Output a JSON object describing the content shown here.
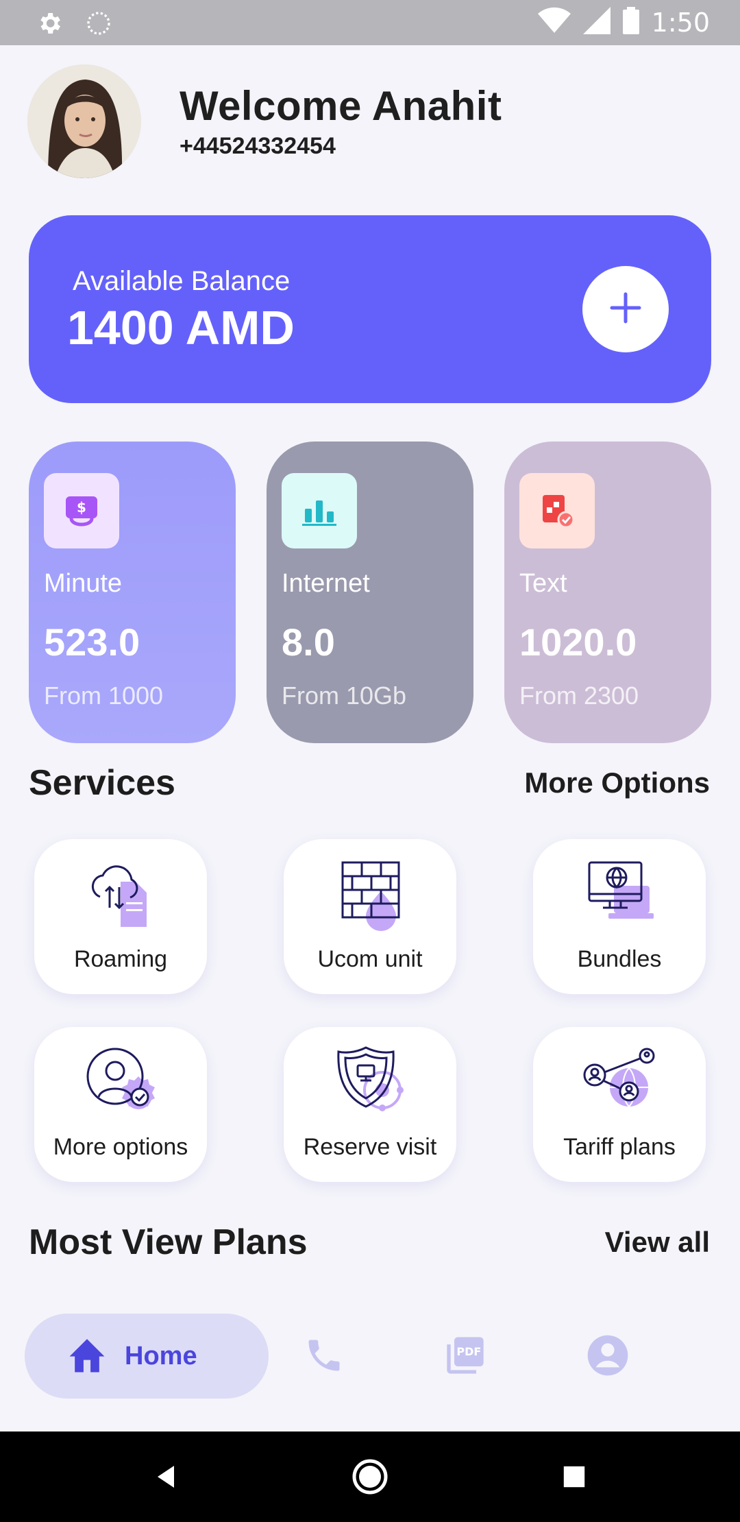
{
  "status_bar": {
    "time": "1:50",
    "icons": [
      "gear-icon",
      "circle-spinner-icon",
      "wifi-icon",
      "signal-icon",
      "battery-icon"
    ]
  },
  "header": {
    "welcome": "Welcome Anahit",
    "phone": "+44524332454"
  },
  "balance": {
    "label": "Available Balance",
    "value": "1400 AMD",
    "add_icon": "plus-icon"
  },
  "usage": [
    {
      "name": "Minute",
      "value": "523.0",
      "from": "From 1000",
      "icon": "dollar-bag-icon"
    },
    {
      "name": "Internet",
      "value": "8.0",
      "from": "From 10Gb",
      "icon": "bar-chart-icon"
    },
    {
      "name": "Text",
      "value": "1020.0",
      "from": "From 2300",
      "icon": "document-check-icon"
    }
  ],
  "services_section": {
    "title": "Services",
    "link": "More Options"
  },
  "services": [
    {
      "label": "Roaming",
      "icon": "cloud-transfer-icon"
    },
    {
      "label": "Ucom unit",
      "icon": "brick-drop-icon"
    },
    {
      "label": "Bundles",
      "icon": "computer-globe-icon"
    },
    {
      "label": "More options",
      "icon": "user-gear-icon"
    },
    {
      "label": "Reserve visit",
      "icon": "shield-monitor-icon"
    },
    {
      "label": "Tariff plans",
      "icon": "network-users-icon"
    }
  ],
  "plans_section": {
    "title": "Most View Plans",
    "link": "View all"
  },
  "bottom_nav": {
    "home_label": "Home",
    "items": [
      "home-icon",
      "phone-icon",
      "pdf-icon",
      "profile-icon"
    ]
  },
  "colors": {
    "accent": "#6461fb",
    "background": "#f4f4fa",
    "icon_purple": "#a78bfa",
    "icon_navy": "#1e1b5e"
  }
}
